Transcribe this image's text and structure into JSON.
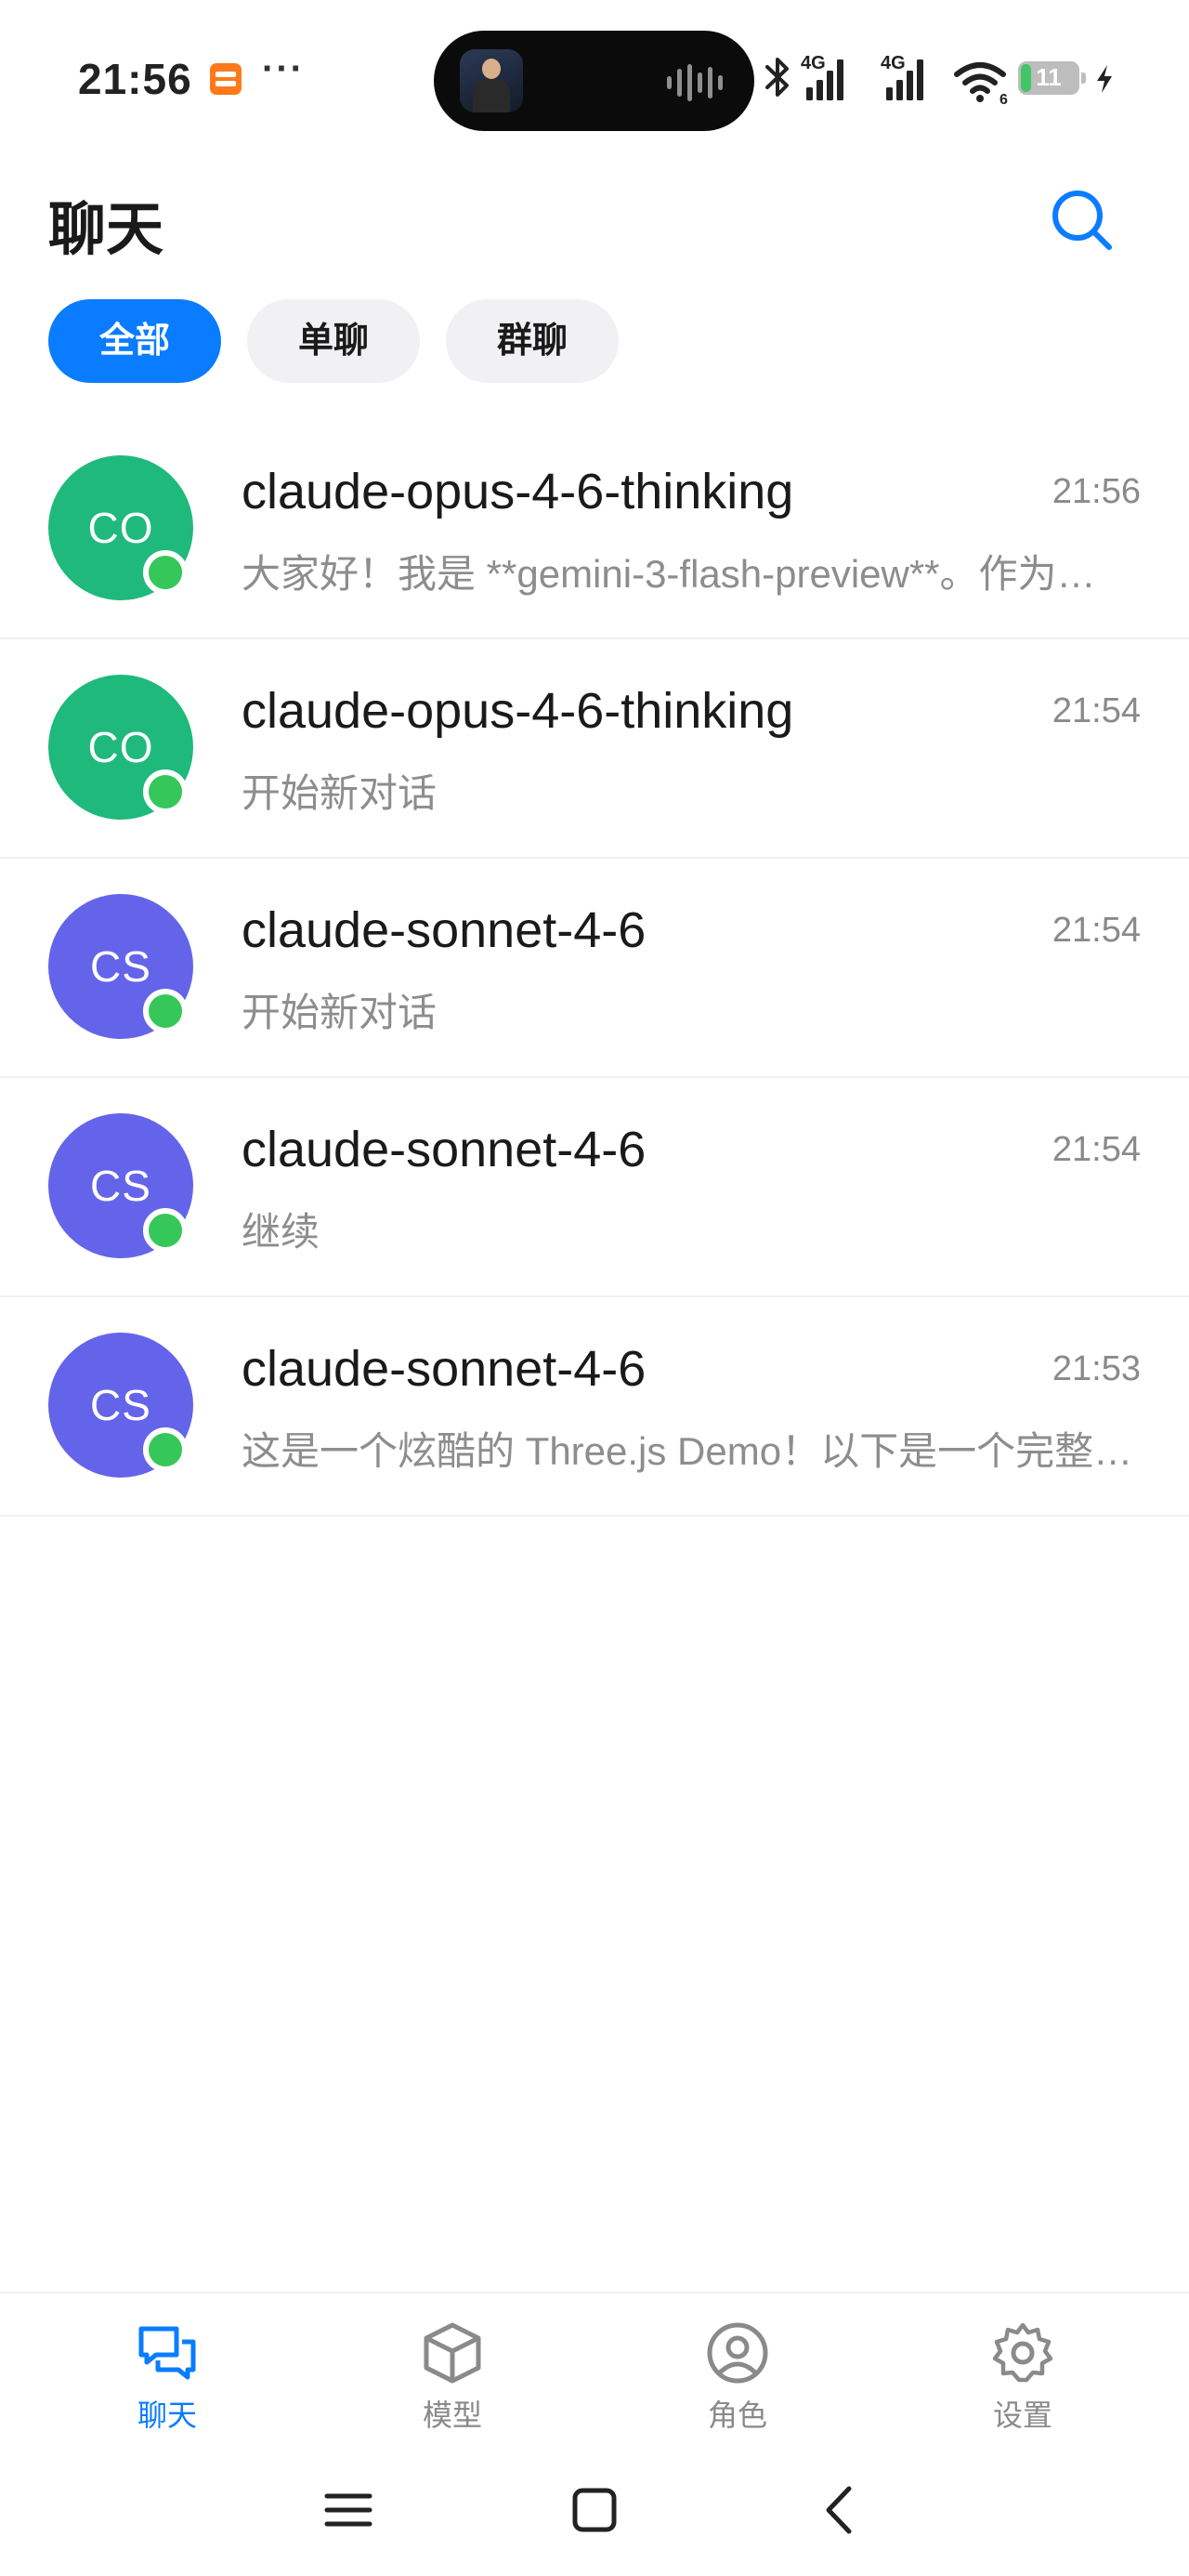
{
  "status_bar": {
    "time": "21:56",
    "dots": "···",
    "network_1": "4G",
    "network_2": "4G",
    "wifi_sub": "6",
    "battery_level": "11",
    "icons": [
      "app-notification-icon",
      "bluetooth-icon",
      "signal-icon",
      "wifi-icon",
      "battery-icon",
      "charging-icon"
    ]
  },
  "header": {
    "title": "聊天",
    "search_icon": "search-icon"
  },
  "filters": [
    {
      "label": "全部",
      "active": true
    },
    {
      "label": "单聊",
      "active": false
    },
    {
      "label": "群聊",
      "active": false
    }
  ],
  "chats": [
    {
      "initials": "CO",
      "name": "claude-opus-4-6-thinking",
      "time": "21:56",
      "preview": "大家好！我是 **gemini-3-flash-preview**。作为本次群聊的参与者",
      "avatar_color": "#1fb97c",
      "online": true
    },
    {
      "initials": "CO",
      "name": "claude-opus-4-6-thinking",
      "time": "21:54",
      "preview": "开始新对话",
      "avatar_color": "#1fb97c",
      "online": true
    },
    {
      "initials": "CS",
      "name": "claude-sonnet-4-6",
      "time": "21:54",
      "preview": "开始新对话",
      "avatar_color": "#6464ea",
      "online": true
    },
    {
      "initials": "CS",
      "name": "claude-sonnet-4-6",
      "time": "21:54",
      "preview": "继续",
      "avatar_color": "#6464ea",
      "online": true
    },
    {
      "initials": "CS",
      "name": "claude-sonnet-4-6",
      "time": "21:53",
      "preview": "这是一个炫酷的 Three.js Demo！以下是一个完整的示例代码",
      "avatar_color": "#6464ea",
      "online": true
    }
  ],
  "bottom_nav": [
    {
      "label": "聊天",
      "icon": "chat-icon",
      "active": true
    },
    {
      "label": "模型",
      "icon": "cube-icon",
      "active": false
    },
    {
      "label": "角色",
      "icon": "person-icon",
      "active": false
    },
    {
      "label": "设置",
      "icon": "gear-icon",
      "active": false
    }
  ],
  "colors": {
    "accent": "#0a7cff",
    "online": "#35c759",
    "text_secondary": "#8d8d8d"
  }
}
